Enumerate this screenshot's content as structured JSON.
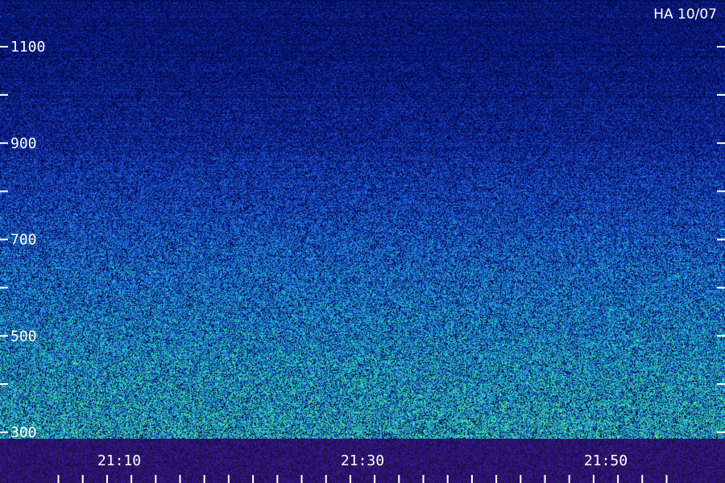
{
  "station_label": "HA 10/07",
  "chart_data": {
    "type": "heatmap",
    "title": "",
    "xlabel": "",
    "ylabel": "",
    "ylim": [
      300,
      1150
    ],
    "y_ticks": [
      300,
      400,
      500,
      600,
      700,
      800,
      900,
      1000,
      1100
    ],
    "y_tick_labels": [
      "300",
      "500",
      "700",
      "900",
      "1100"
    ],
    "xlim": [
      "21:05",
      "21:55"
    ],
    "x_tick_labels": [
      "21:10",
      "21:30",
      "21:50"
    ],
    "x_tick_values": [
      "21:10",
      "21:30",
      "21:50"
    ],
    "intensity_profile": [
      {
        "y": 300,
        "level": 0.78
      },
      {
        "y": 400,
        "level": 0.74
      },
      {
        "y": 500,
        "level": 0.66
      },
      {
        "y": 600,
        "level": 0.58
      },
      {
        "y": 700,
        "level": 0.5
      },
      {
        "y": 800,
        "level": 0.4
      },
      {
        "y": 900,
        "level": 0.32
      },
      {
        "y": 1000,
        "level": 0.26
      },
      {
        "y": 1100,
        "level": 0.22
      }
    ],
    "colormap": [
      "#000020",
      "#0a1a8c",
      "#1f5fe0",
      "#1fb0d8",
      "#2ee0a0",
      "#7cff6a"
    ],
    "grid": false
  }
}
